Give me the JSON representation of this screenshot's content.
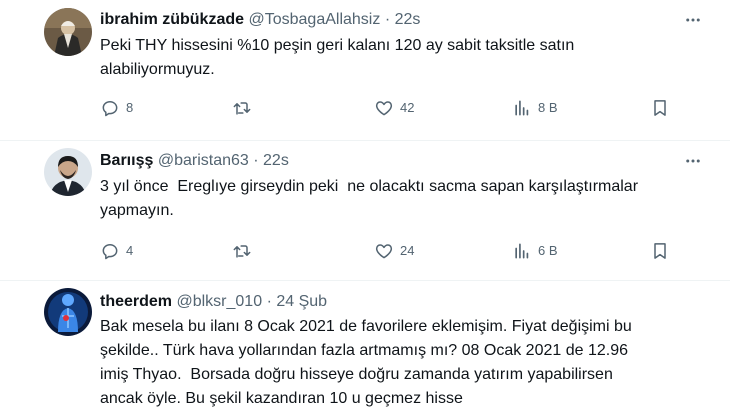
{
  "tweets": [
    {
      "name": "ibrahim zübükzade",
      "handle": "@TosbagaAllahsiz",
      "sep": "·",
      "time": "22s",
      "text": "Peki THY hissesini %10 peşin geri kalanı 120 ay sabit taksitle satın\nalabiliyormuyuz.",
      "reply_count": "8",
      "retweet_count": "",
      "like_count": "42",
      "view_count": "8 B"
    },
    {
      "name": "Barıışş",
      "handle": "@baristan63",
      "sep": "·",
      "time": "22s",
      "text": "3 yıl önce  Ereglıye girseydin peki  ne olacaktı sacma sapan karşılaştırmalar\nyapmayın.",
      "reply_count": "4",
      "retweet_count": "",
      "like_count": "24",
      "view_count": "6 B"
    },
    {
      "name": "theerdem",
      "handle": "@blksr_010",
      "sep": "·",
      "time": "24 Şub",
      "text": "Bak mesela bu ilanı 8 Ocak 2021 de favorilere eklemişim. Fiyat değişimi bu\nşekilde.. Türk hava yollarından fazla artmamış mı? 08 Ocak 2021 de 12.96\nimiş Thyao.  Borsada doğru hisseye doğru zamanda yatırım yapabilirsen\nancak öyle. Bu şekil kazandıran 10 u geçmez hisse"
    }
  ],
  "icons": {
    "reply": "reply-icon",
    "retweet": "retweet-icon",
    "like": "like-icon",
    "views": "views-icon",
    "bookmark": "bookmark-icon",
    "more": "more-icon"
  },
  "colors": {
    "text": "#0f1419",
    "secondary": "#536471",
    "divider": "#eff3f4"
  }
}
